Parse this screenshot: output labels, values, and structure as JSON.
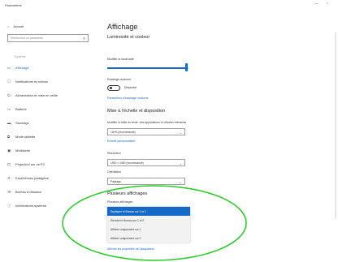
{
  "window": {
    "title": "Paramètres",
    "minimize": "–",
    "maximize": "▫"
  },
  "sidebar": {
    "home": "Accueil",
    "search_placeholder": "Rechercher un paramètre",
    "section": "Système",
    "items": [
      {
        "label": "Affichage",
        "icon": "monitor-icon",
        "active": true
      },
      {
        "label": "Notifications et actions",
        "icon": "notification-icon",
        "active": false
      },
      {
        "label": "Alimentation et mise en veille",
        "icon": "power-icon",
        "active": false
      },
      {
        "label": "Batterie",
        "icon": "battery-icon",
        "active": false
      },
      {
        "label": "Stockage",
        "icon": "storage-icon",
        "active": false
      },
      {
        "label": "Mode tablette",
        "icon": "tablet-icon",
        "active": false
      },
      {
        "label": "Multitâche",
        "icon": "multitask-icon",
        "active": false
      },
      {
        "label": "Projection sur ce PC",
        "icon": "projection-icon",
        "active": false
      },
      {
        "label": "Expériences partagées",
        "icon": "shared-icon",
        "active": false
      },
      {
        "label": "Bureau à distance",
        "icon": "remote-icon",
        "active": false
      },
      {
        "label": "Informations système",
        "icon": "info-icon",
        "active": false
      }
    ]
  },
  "main": {
    "title": "Affichage",
    "brightness": {
      "heading": "Luminosité et couleur",
      "label": "Modifier la luminosité",
      "value_fraction": 0.97
    },
    "night": {
      "label": "Éclairage nocturne",
      "state": "Désactivé",
      "link": "Paramètres d'éclairage nocturne"
    },
    "layout": {
      "heading": "Mise à l'échelle et disposition",
      "scale_label": "Modifier la taille du texte, des applications et d'autres éléments",
      "scale_value": "100% (recommandé)",
      "scale_link": "Échelle personnalisée",
      "resolution_label": "Résolution",
      "resolution_value": "1920 × 1080 (recommandé)",
      "orientation_label": "Orientation",
      "orientation_value": "Paysage"
    },
    "multi": {
      "heading": "Plusieurs affichages",
      "label": "Plusieurs affichages",
      "options": [
        "Dupliquer le Bureau sur 1 et 2",
        "Étendre le Bureau sur 1 et 2",
        "Afficher uniquement sur 1",
        "Afficher uniquement sur 2"
      ],
      "selected_index": 0,
      "link": "Afficher les propriétés de l'adaptateur"
    }
  },
  "colors": {
    "accent": "#1569c7",
    "annotation": "#22cc22"
  }
}
